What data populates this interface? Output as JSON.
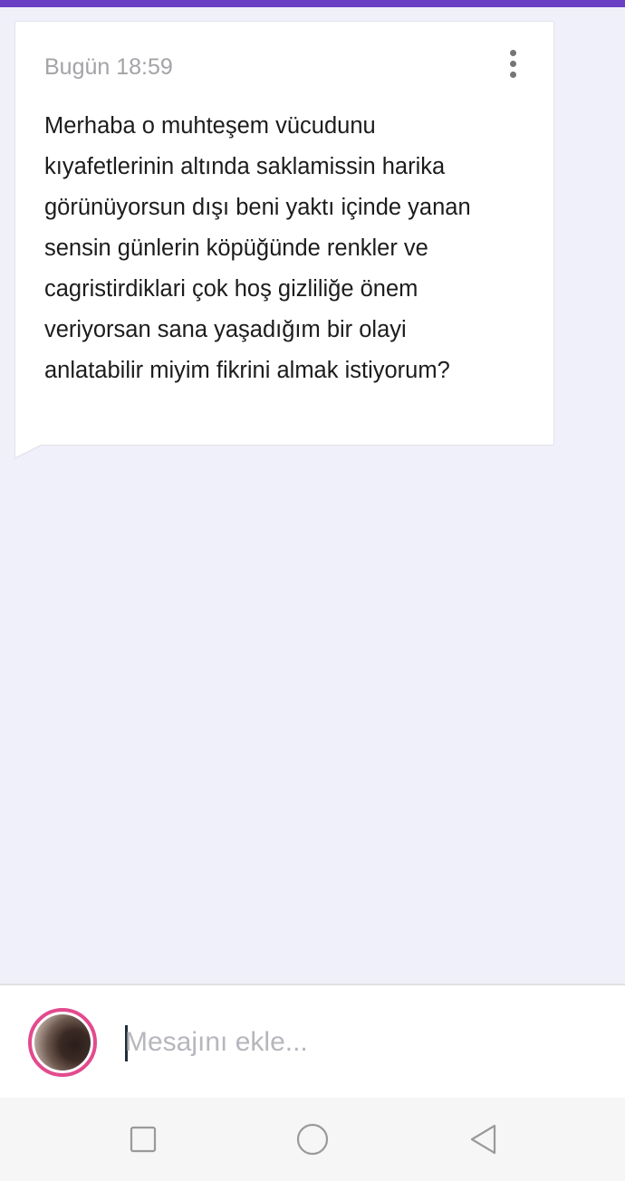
{
  "colors": {
    "accent": "#6a3fc4",
    "background": "#f0f0fa",
    "avatar_ring": "#e34a8e"
  },
  "message": {
    "timestamp": "Bugün 18:59",
    "menu_icon": "more-vertical-icon",
    "text": "Merhaba o muhteşem vücudunu\nkıyafetlerinin altında saklamissin harika\ngörünüyorsun dışı beni yaktı içinde yanan\nsensin günlerin köpüğünde renkler ve\ncagristirdiklari çok hoş gizliliğe önem\nveriyorsan sana yaşadığım bir olayi\nanlatabilir miyim fikrini almak istiyorum?"
  },
  "composer": {
    "placeholder": "Mesajını ekle...",
    "value": ""
  },
  "nav": {
    "recent_icon": "square-icon",
    "home_icon": "circle-icon",
    "back_icon": "triangle-back-icon"
  }
}
